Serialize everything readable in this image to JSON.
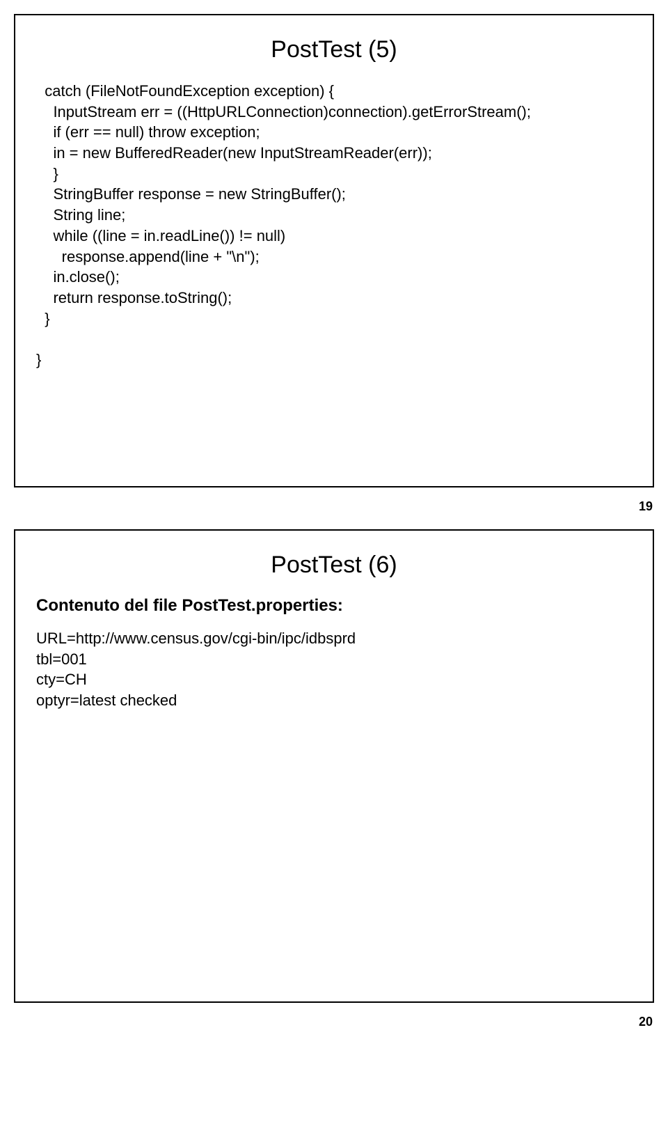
{
  "slide1": {
    "title": "PostTest (5)",
    "code": "  catch (FileNotFoundException exception) {\n    InputStream err = ((HttpURLConnection)connection).getErrorStream();\n    if (err == null) throw exception;\n    in = new BufferedReader(new InputStreamReader(err));\n    }\n    StringBuffer response = new StringBuffer();\n    String line;\n    while ((line = in.readLine()) != null)\n      response.append(line + \"\\n\");\n    in.close();\n    return response.toString();\n  }\n\n}",
    "pageNum": "19"
  },
  "slide2": {
    "title": "PostTest (6)",
    "subheading": "Contenuto del file PostTest.properties:",
    "props": "URL=http://www.census.gov/cgi-bin/ipc/idbsprd\ntbl=001\ncty=CH\noptyr=latest checked",
    "pageNum": "20"
  }
}
